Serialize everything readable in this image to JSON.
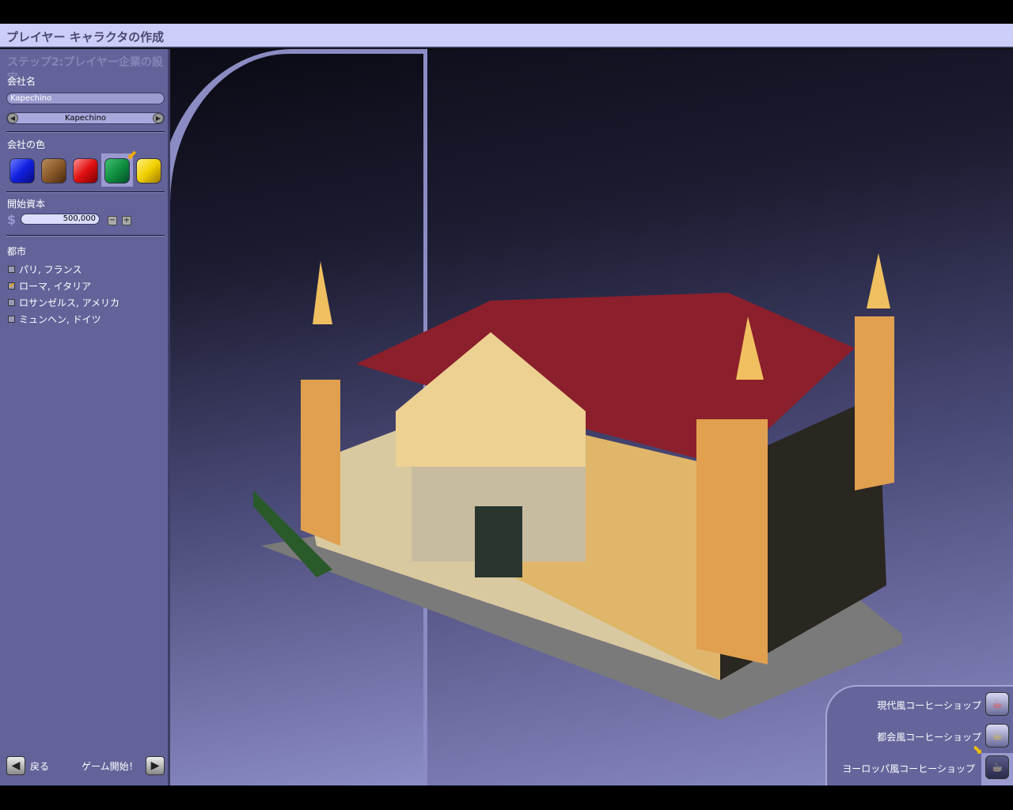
{
  "title": "プレイヤー キャラクタの作成",
  "step": "ステップ2:プレイヤー企業の設定",
  "company_name": {
    "label": "会社名",
    "value": "Kapechino",
    "spinner_value": "Kapechino"
  },
  "company_color": {
    "label": "会社の色",
    "options": [
      "#1020e0",
      "#8a5a2a",
      "#e01010",
      "#109040",
      "#f0d000"
    ],
    "selected": 3
  },
  "capital": {
    "label": "開始資本",
    "currency": "$",
    "value": "500,000",
    "minus": "−",
    "plus": "+"
  },
  "cities": {
    "label": "都市",
    "items": [
      {
        "label": "パリ, フランス",
        "checked": false
      },
      {
        "label": "ローマ, イタリア",
        "checked": true
      },
      {
        "label": "ロサンゼルス, アメリカ",
        "checked": false
      },
      {
        "label": "ミュンヘン, ドイツ",
        "checked": false
      }
    ]
  },
  "nav": {
    "back": "戻る",
    "start": "ゲーム開始！"
  },
  "shops": [
    {
      "label": "現代風コーヒーショップ"
    },
    {
      "label": "都会風コーヒーショップ"
    },
    {
      "label": "ヨーロッパ風コーヒーショップ",
      "selected": true
    }
  ]
}
